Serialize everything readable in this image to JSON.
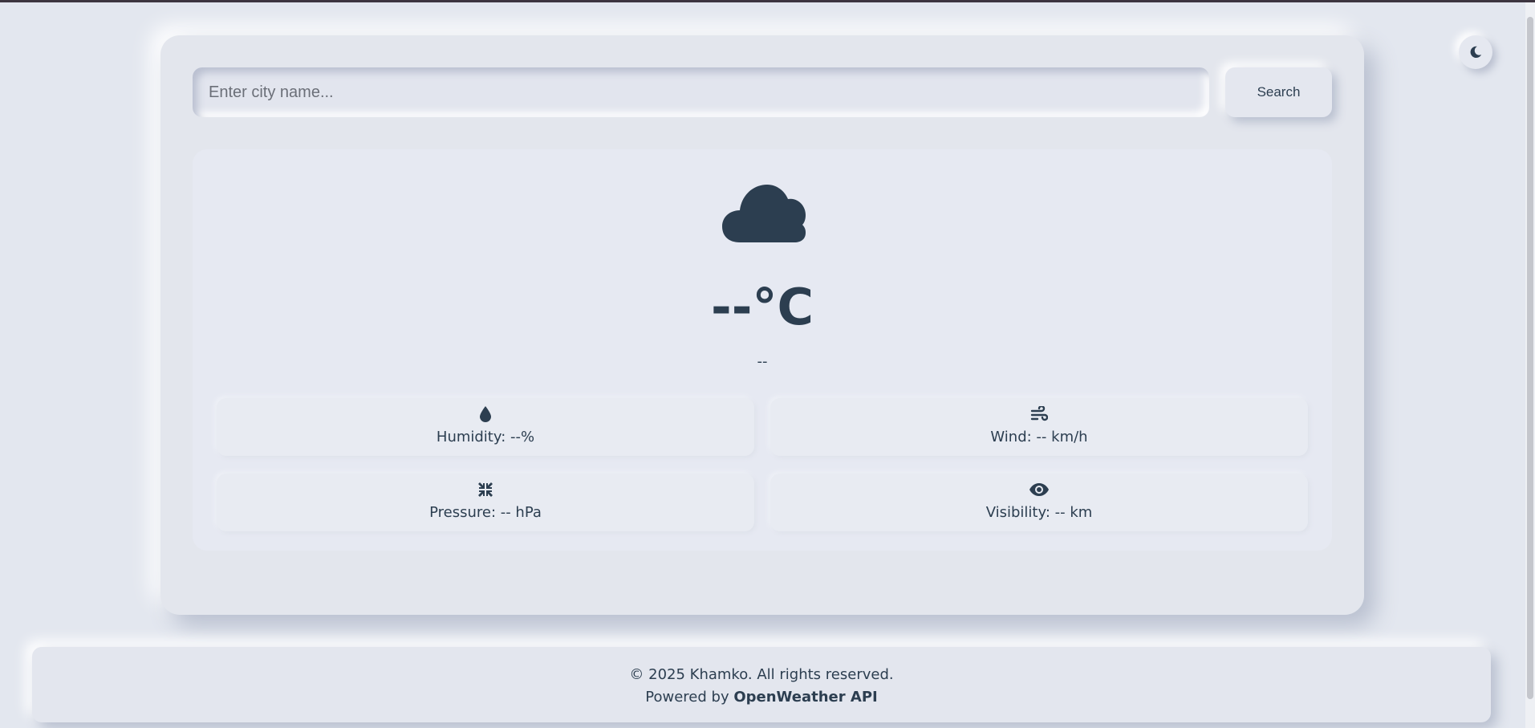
{
  "search": {
    "placeholder": "Enter city name...",
    "value": "",
    "button_label": "Search"
  },
  "theme_toggle": {
    "icon": "moon-icon"
  },
  "weather": {
    "icon": "cloud-icon",
    "temperature": "--°C",
    "description": "--",
    "details": [
      {
        "icon": "droplet-icon",
        "label": "Humidity: --%"
      },
      {
        "icon": "wind-icon",
        "label": "Wind: -- km/h"
      },
      {
        "icon": "compress-icon",
        "label": "Pressure: -- hPa"
      },
      {
        "icon": "eye-icon",
        "label": "Visibility: -- km"
      }
    ]
  },
  "footer": {
    "copyright": "© 2025 Khamko. All rights reserved.",
    "powered_prefix": "Powered by ",
    "powered_link": "OpenWeather API"
  },
  "colors": {
    "background": "#e3e7ef",
    "text": "#2c3e50",
    "icon": "#2c3e50"
  }
}
